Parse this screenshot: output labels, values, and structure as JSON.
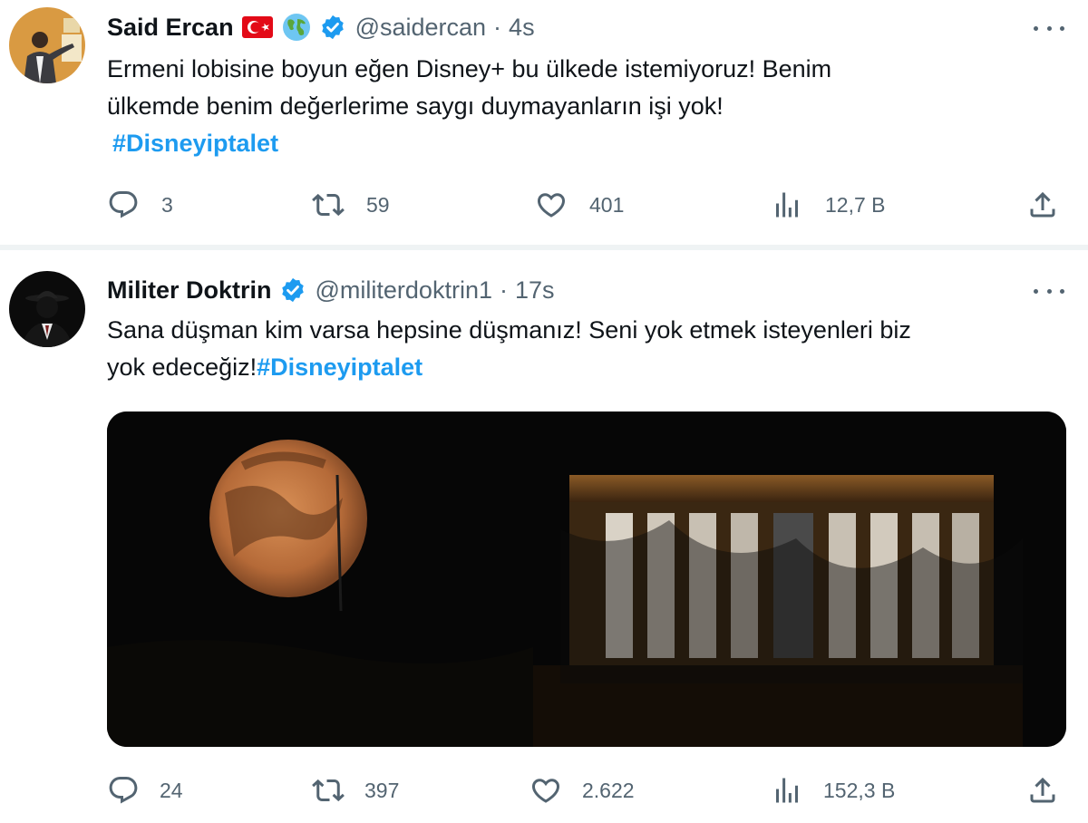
{
  "tweets": [
    {
      "author": {
        "name": "Said Ercan",
        "handle": "@saidercan",
        "time": "4s",
        "separator": "·"
      },
      "text": {
        "line1": "Ermeni lobisine boyun eğen Disney+ bu ülkede istemiyoruz! Benim",
        "line2": "ülkemde benim değerlerime saygı duymayanların işi yok!",
        "hashtag": "#Disneyiptalet"
      },
      "stats": {
        "replies": "3",
        "retweets": "59",
        "likes": "401",
        "views": "12,7 B"
      },
      "icons": [
        "turkey-flag-icon",
        "globe-icon",
        "verified-badge-icon"
      ]
    },
    {
      "author": {
        "name": "Militer Doktrin",
        "handle": "@militerdoktrin1",
        "time": "17s",
        "separator": "·"
      },
      "text": {
        "line1": "Sana düşman kim varsa hepsine düşmanız! Seni yok etmek isteyenleri biz",
        "line2_prefix": "yok edeceğiz!",
        "hashtag": "#Disneyiptalet"
      },
      "stats": {
        "replies": "24",
        "retweets": "397",
        "likes": "2.622",
        "views": "152,3 B"
      },
      "icons": [
        "verified-badge-icon"
      ]
    }
  ],
  "colors": {
    "accent": "#1d9bf0",
    "text": "#0f1419",
    "secondary": "#536471",
    "divider": "#eff3f4",
    "moon": "#c9804a"
  }
}
